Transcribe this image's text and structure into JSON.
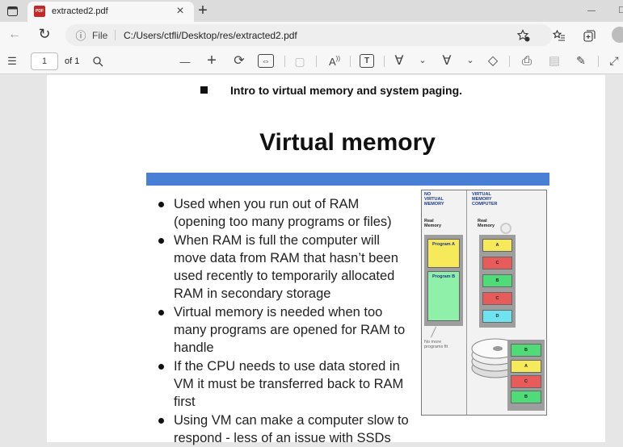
{
  "browser": {
    "tab_title": "extracted2.pdf",
    "close_tab": "×",
    "new_tab": "+",
    "minimize": "—",
    "maximize": "□",
    "url_scheme_label": "File",
    "url": "C:/Users/ctfli/Desktop/res/extracted2.pdf",
    "back_icon": "←",
    "reload_icon": "↻",
    "info_icon": "ⓘ"
  },
  "pdf_toolbar": {
    "contents_icon": "☰",
    "page_number": "1",
    "page_total": "of 1",
    "search_icon": "⚲",
    "zoom_out": "—",
    "zoom_in": "+",
    "rotate_icon": "⟳",
    "fit_icon": "⇔",
    "two_page_icon": "▢",
    "read_aloud": "A",
    "text_icon": "T",
    "draw_icon": "∀",
    "draw_chevron": "⌄",
    "highlight_icon": "∀",
    "highlight_chevron": "⌄",
    "erase_icon": "◇",
    "print_icon": "⎙",
    "save_icon": "▤",
    "save_as_icon": "✎",
    "expand_icon": "⤢"
  },
  "document": {
    "heading": "Intro to virtual memory and system paging.",
    "slide": {
      "title": "Virtual memory",
      "bullets": [
        "Used when you run out of RAM (opening too many programs or files)",
        "When RAM is full the computer will move data from RAM that hasn’t been used recently to temporarily allocated RAM in secondary storage",
        "Virtual memory is needed when too many programs are opened for RAM to handle",
        "If the CPU needs to use data stored in VM it must be transferred back to RAM first",
        "Using VM can make a computer slow to respond - less of an issue with SSDs"
      ]
    },
    "diagram": {
      "left_header": "NO VIRTUAL MEMORY",
      "right_header": "VIRTUAL MEMORY COMPUTER",
      "real_memory_left": "Real Memory",
      "real_memory_right": "Real Memory",
      "program_a": "Program A",
      "program_b": "Program B",
      "no_more_note": "No more programs fit",
      "ram_blocks": [
        "A",
        "C",
        "B",
        "C",
        "D"
      ],
      "disk_blocks": [
        "B",
        "A",
        "C",
        "B"
      ],
      "colors": {
        "yellow": "#f6ea5a",
        "red": "#e85b5b",
        "green": "#4fdc78",
        "cyan": "#6fe3f0",
        "mint": "#8ef0a9"
      }
    }
  }
}
